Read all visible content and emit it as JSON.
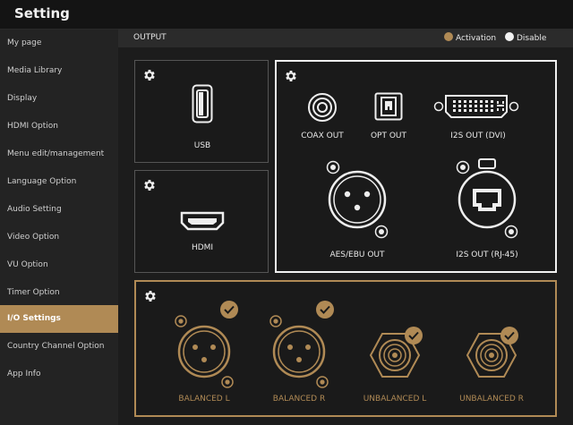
{
  "header": {
    "title": "Setting"
  },
  "sidebar": {
    "items": [
      {
        "label": "My page"
      },
      {
        "label": "Media Library"
      },
      {
        "label": "Display"
      },
      {
        "label": "HDMI Option"
      },
      {
        "label": "Menu edit/management"
      },
      {
        "label": "Language Option"
      },
      {
        "label": "Audio Setting"
      },
      {
        "label": "Video Option"
      },
      {
        "label": "VU Option"
      },
      {
        "label": "Timer Option"
      },
      {
        "label": "I/O Settings"
      },
      {
        "label": "Country Channel Option"
      },
      {
        "label": "App Info"
      }
    ],
    "active_index": 10
  },
  "output": {
    "label": "OUTPUT",
    "legend": {
      "activation": "Activation",
      "disable": "Disable"
    }
  },
  "panels": {
    "usb": {
      "label": "USB"
    },
    "hdmi": {
      "label": "HDMI"
    },
    "digital": {
      "coax": "COAX OUT",
      "opt": "OPT OUT",
      "i2s_dvi": "I2S OUT (DVI)",
      "aes": "AES/EBU OUT",
      "i2s_rj45": "I2S OUT (RJ-45)"
    },
    "analog": {
      "balanced_l": "BALANCED L",
      "balanced_r": "BALANCED R",
      "unbalanced_l": "UNBALANCED L",
      "unbalanced_r": "UNBALANCED R"
    }
  },
  "colors": {
    "accent": "#b08a55",
    "active_bg": "#b08a55",
    "white": "#f0f0f0"
  },
  "icons": [
    "gear-icon",
    "usb-port-icon",
    "hdmi-port-icon",
    "coax-jack-icon",
    "optical-port-icon",
    "dvi-port-icon",
    "xlr-jack-icon",
    "rj45-port-icon",
    "rca-jack-icon",
    "checkmark-icon"
  ]
}
